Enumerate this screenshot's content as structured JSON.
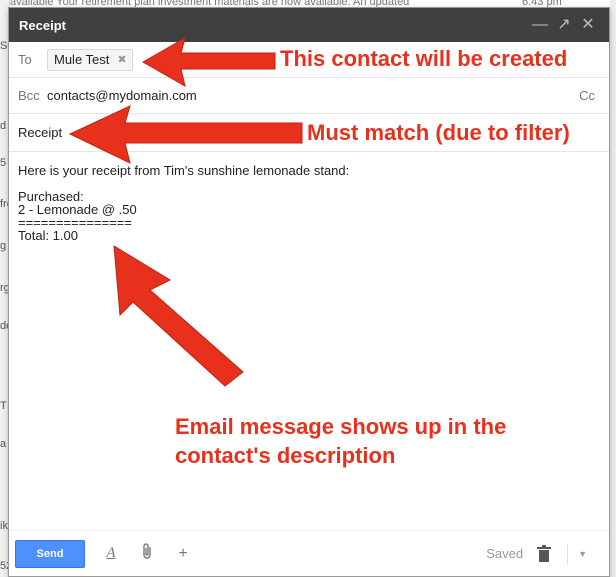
{
  "background": {
    "top_snippet": "available   Your retirement plan investment materials are now available. An updated",
    "top_time": "6:43 pm",
    "left_letters": [
      "Se",
      "",
      "d",
      "5",
      "fre",
      "g",
      "de",
      "rg",
      "e",
      "",
      "T",
      "",
      "",
      "5",
      "",
      "a",
      "ik",
      "52"
    ]
  },
  "compose": {
    "title": "Receipt",
    "to_label": "To",
    "to_chip": "Mule Test",
    "bcc_label": "Bcc",
    "bcc_value": "contacts@mydomain.com",
    "cc_link": "Cc",
    "subject": "Receipt",
    "body_lines": [
      "Here is your receipt from Tim's sunshine lemonade stand:",
      "",
      "Purchased:",
      "2 - Lemonade @ .50",
      "===============",
      "Total: 1.00"
    ]
  },
  "toolbar": {
    "send_label": "Send",
    "format_icon": "A",
    "attach_icon": "paperclip-icon",
    "insert_icon": "plus-icon",
    "saved_label": "Saved",
    "trash_icon": "trash-icon",
    "more_icon": "chevron-down-icon"
  },
  "annotations": {
    "contact_created": "This contact will be created",
    "must_match": "Must match (due to filter)",
    "email_message_line1": "Email message shows up in the",
    "email_message_line2": "contact's description"
  },
  "colors": {
    "annotation": "#e8311c",
    "send_button": "#4d90fe",
    "titlebar": "#404040"
  }
}
